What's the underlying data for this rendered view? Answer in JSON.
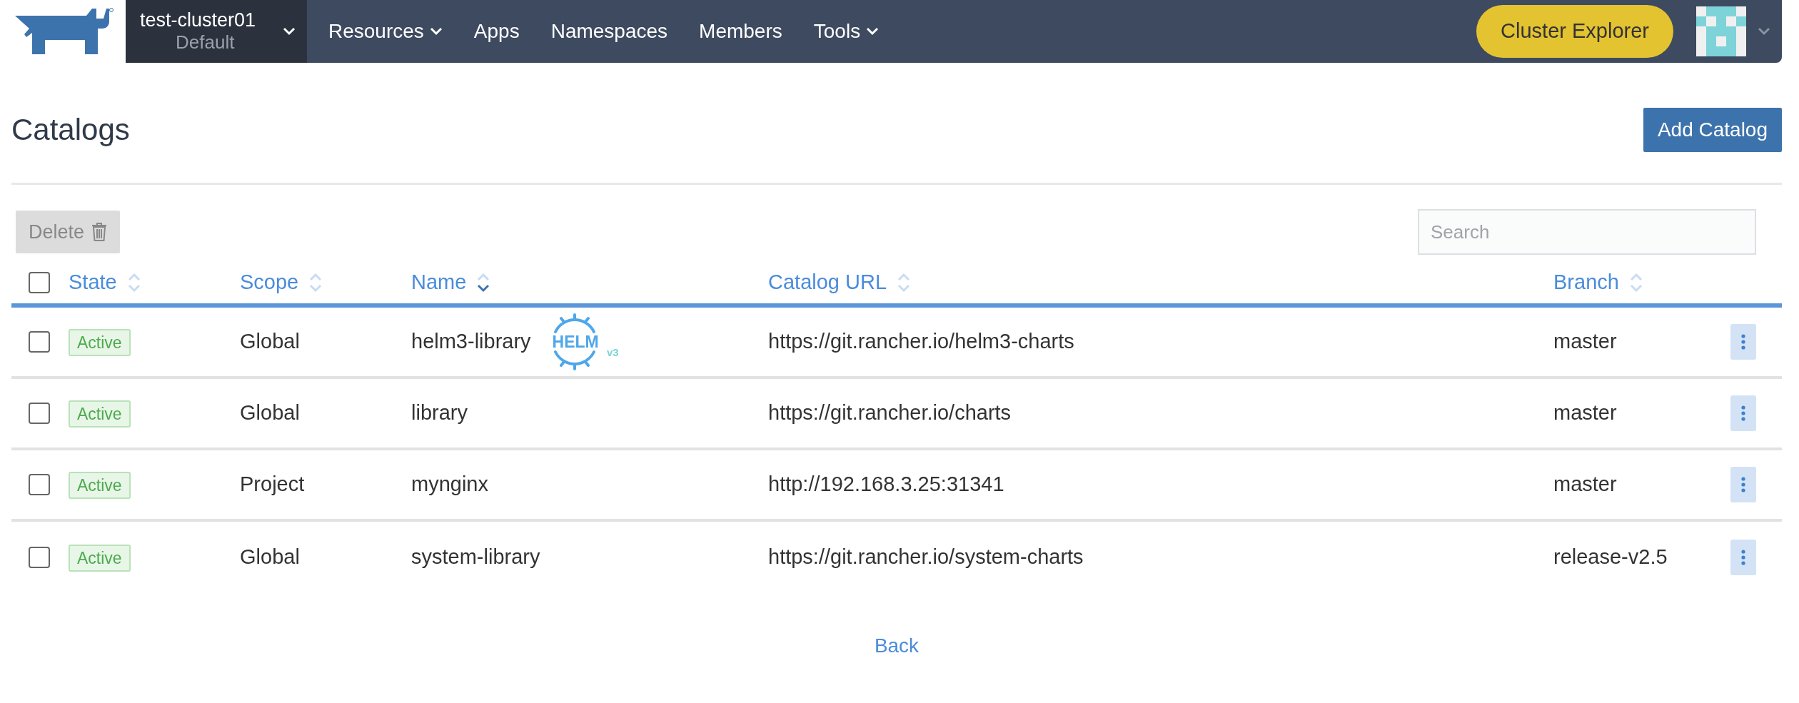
{
  "header": {
    "cluster": {
      "name": "test-cluster01",
      "project": "Default"
    },
    "nav": [
      {
        "label": "Resources",
        "dropdown": true
      },
      {
        "label": "Apps",
        "dropdown": false
      },
      {
        "label": "Namespaces",
        "dropdown": false
      },
      {
        "label": "Members",
        "dropdown": false
      },
      {
        "label": "Tools",
        "dropdown": true
      }
    ],
    "explorer_button": "Cluster Explorer"
  },
  "page": {
    "title": "Catalogs",
    "add_button": "Add Catalog"
  },
  "toolbar": {
    "delete_button": "Delete",
    "delete_disabled": true,
    "search": {
      "placeholder": "Search"
    }
  },
  "table": {
    "select_all_checked": false,
    "columns": [
      {
        "label": "State",
        "sorted": false
      },
      {
        "label": "Scope",
        "sorted": false
      },
      {
        "label": "Name",
        "sorted": true
      },
      {
        "label": "Catalog URL",
        "sorted": false
      },
      {
        "label": "Branch",
        "sorted": false
      }
    ],
    "rows": [
      {
        "checked": false,
        "state": "Active",
        "scope": "Global",
        "name": "helm3-library",
        "helm": {
          "label": "HELM",
          "version": "v3"
        },
        "url": "https://git.rancher.io/helm3-charts",
        "branch": "master"
      },
      {
        "checked": false,
        "state": "Active",
        "scope": "Global",
        "name": "library",
        "url": "https://git.rancher.io/charts",
        "branch": "master"
      },
      {
        "checked": false,
        "state": "Active",
        "scope": "Project",
        "name": "mynginx",
        "url": "http://192.168.3.25:31341",
        "branch": "master"
      },
      {
        "checked": false,
        "state": "Active",
        "scope": "Global",
        "name": "system-library",
        "url": "https://git.rancher.io/system-charts",
        "branch": "release-v2.5"
      }
    ]
  },
  "back_link": "Back"
}
